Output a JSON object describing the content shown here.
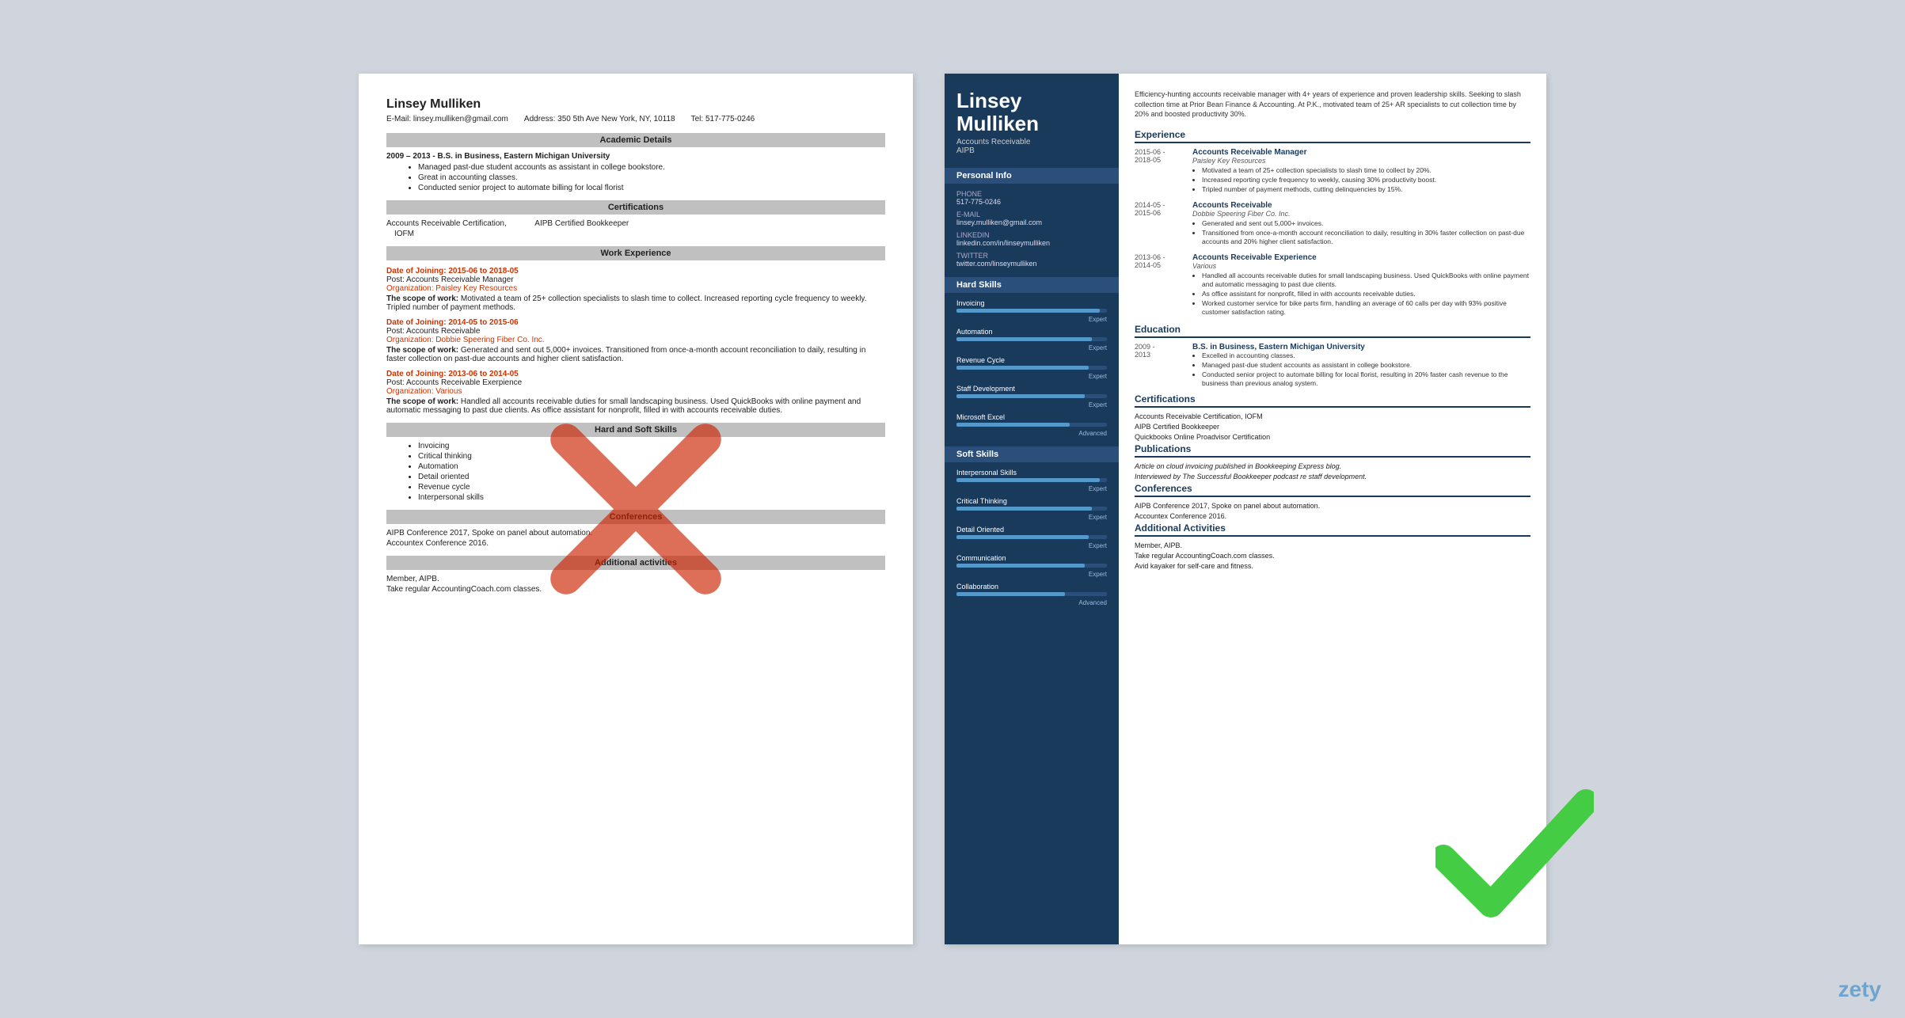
{
  "bad_resume": {
    "name": "Linsey Mulliken",
    "email": "E-Mail: linsey.mulliken@gmail.com",
    "address": "Address: 350 5th Ave New York, NY, 10118",
    "tel": "Tel: 517-775-0246",
    "sections": {
      "academic": {
        "title": "Academic Details",
        "degree": "2009 – 2013 - B.S. in Business, Eastern Michigan University",
        "bullets": [
          "Managed past-due student accounts as assistant in college bookstore.",
          "Great in accounting classes.",
          "Conducted senior project to automate billing for local florist"
        ]
      },
      "certifications": {
        "title": "Certifications",
        "items": [
          "Accounts Receivable Certification,",
          "IOFM",
          "AIPB Certified Bookkeeper"
        ]
      },
      "work": {
        "title": "Work Experience",
        "jobs": [
          {
            "date_label": "Date of Joining:",
            "date": "2015-06 to 2018-05",
            "post_label": "Post:",
            "post": "Accounts Receivable Manager",
            "org_label": "Organization:",
            "org": "Paisley Key Resources",
            "scope_label": "The scope of work:",
            "scope": "Motivated a team of 25+ collection specialists to slash time to collect. Increased reporting cycle frequency to weekly. Tripled number of payment methods."
          },
          {
            "date_label": "Date of Joining:",
            "date": "2014-05 to 2015-06",
            "post_label": "Post:",
            "post": "Accounts Receivable",
            "org_label": "Organization:",
            "org": "Dobbie Speering Fiber Co. Inc.",
            "scope_label": "The scope of work:",
            "scope": "Generated and sent out 5,000+ invoices. Transitioned from once-a-month account reconciliation to daily, resulting in faster collection on past-due accounts and higher client satisfaction."
          },
          {
            "date_label": "Date of Joining:",
            "date": "2013-06 to 2014-05",
            "post_label": "Post:",
            "post": "Accounts Receivable Exerpience",
            "org_label": "Organization:",
            "org": "Various",
            "scope_label": "The scope of work:",
            "scope": "Handled all accounts receivable duties for small landscaping business. Used QuickBooks with online payment and automatic messaging to past due clients. As office assistant for nonprofit, filled in with accounts receivable duties."
          }
        ]
      },
      "skills": {
        "title": "Hard and Soft Skills",
        "items": [
          "Invoicing",
          "Critical thinking",
          "Automation",
          "Detail oriented",
          "Revenue cycle",
          "Interpersonal skills"
        ]
      },
      "conferences": {
        "title": "Conferences",
        "items": [
          "AIPB Conference 2017, Spoke on panel about automation.",
          "Accountex Conference 2016."
        ]
      },
      "additional": {
        "title": "Additional activities",
        "items": [
          "Member, AIPB.",
          "Take regular AccountingCoach.com classes."
        ]
      }
    }
  },
  "good_resume": {
    "name": "Linsey\nMulliken",
    "title": "Accounts Receivable",
    "title2": "AIPB",
    "summary": "Efficiency-hunting accounts receivable manager with 4+ years of experience and proven leadership skills. Seeking to slash collection time at Prior Bean Finance & Accounting. At P.K., motivated team of 25+ AR specialists to cut collection time by 20% and boosted productivity 30%.",
    "sidebar": {
      "personal_info_title": "Personal Info",
      "phone_label": "Phone",
      "phone": "517-775-0246",
      "email_label": "E-mail",
      "email": "linsey.mulliken@gmail.com",
      "linkedin_label": "LinkedIn",
      "linkedin": "linkedin.com/in/linseymulliken",
      "twitter_label": "Twitter",
      "twitter": "twitter.com/linseymulliken",
      "hard_skills_title": "Hard Skills",
      "hard_skills": [
        {
          "name": "Invoicing",
          "level": "Expert",
          "pct": 95
        },
        {
          "name": "Automation",
          "level": "Expert",
          "pct": 90
        },
        {
          "name": "Revenue Cycle",
          "level": "Expert",
          "pct": 88
        },
        {
          "name": "Staff Development",
          "level": "Expert",
          "pct": 85
        },
        {
          "name": "Microsoft Excel",
          "level": "Advanced",
          "pct": 75
        }
      ],
      "soft_skills_title": "Soft Skills",
      "soft_skills": [
        {
          "name": "Interpersonal Skills",
          "level": "Expert",
          "pct": 95
        },
        {
          "name": "Critical Thinking",
          "level": "Expert",
          "pct": 90
        },
        {
          "name": "Detail Oriented",
          "level": "Expert",
          "pct": 88
        },
        {
          "name": "Communication",
          "level": "Expert",
          "pct": 85
        },
        {
          "name": "Collaboration",
          "level": "Advanced",
          "pct": 72
        }
      ]
    },
    "experience": {
      "title": "Experience",
      "jobs": [
        {
          "date": "2015-06 -\n2018-05",
          "title": "Accounts Receivable Manager",
          "org": "Paisley Key Resources",
          "bullets": [
            "Motivated a team of 25+ collection specialists to slash time to collect by 20%.",
            "Increased reporting cycle frequency to weekly, causing 30% productivity boost.",
            "Tripled number of payment methods, cutting delinquencies by 15%."
          ]
        },
        {
          "date": "2014-05 -\n2015-06",
          "title": "Accounts Receivable",
          "org": "Dobbie Speering Fiber Co. Inc.",
          "bullets": [
            "Generated and sent out 5,000+ invoices.",
            "Transitioned from once-a-month account reconciliation to daily, resulting in 30% faster collection on past-due accounts and 20% higher client satisfaction."
          ]
        },
        {
          "date": "2013-06 -\n2014-05",
          "title": "Accounts Receivable Experience",
          "org": "Various",
          "bullets": [
            "Handled all accounts receivable duties for small landscaping business. Used QuickBooks with online payment and automatic messaging to past due clients.",
            "As office assistant for nonprofit, filled in with accounts receivable duties.",
            "Worked customer service for bike parts firm, handling an average of 60 calls per day with 93% positive customer satisfaction rating."
          ]
        }
      ]
    },
    "education": {
      "title": "Education",
      "items": [
        {
          "date": "2009 -\n2013",
          "degree": "B.S. in Business, Eastern Michigan University",
          "bullets": [
            "Excelled in accounting classes.",
            "Managed past-due student accounts as assistant in college bookstore.",
            "Conducted senior project to automate billing for local florist, resulting in 20% faster cash revenue to the business than previous analog system."
          ]
        }
      ]
    },
    "certifications": {
      "title": "Certifications",
      "items": [
        "Accounts Receivable Certification, IOFM",
        "AIPB Certified Bookkeeper",
        "Quickbooks Online Proadvisor Certification"
      ]
    },
    "publications": {
      "title": "Publications",
      "items": [
        "Article on cloud invoicing published in Bookkeeping Express blog.",
        "Interviewed by The Successful Bookkeeper podcast re staff development."
      ]
    },
    "conferences": {
      "title": "Conferences",
      "items": [
        "AIPB Conference 2017, Spoke on panel about automation.",
        "Accountex Conference 2016."
      ]
    },
    "additional": {
      "title": "Additional Activities",
      "items": [
        "Member, AIPB.",
        "Take regular AccountingCoach.com classes.",
        "Avid kayaker for self-care and fitness."
      ]
    }
  },
  "brand": "zety"
}
